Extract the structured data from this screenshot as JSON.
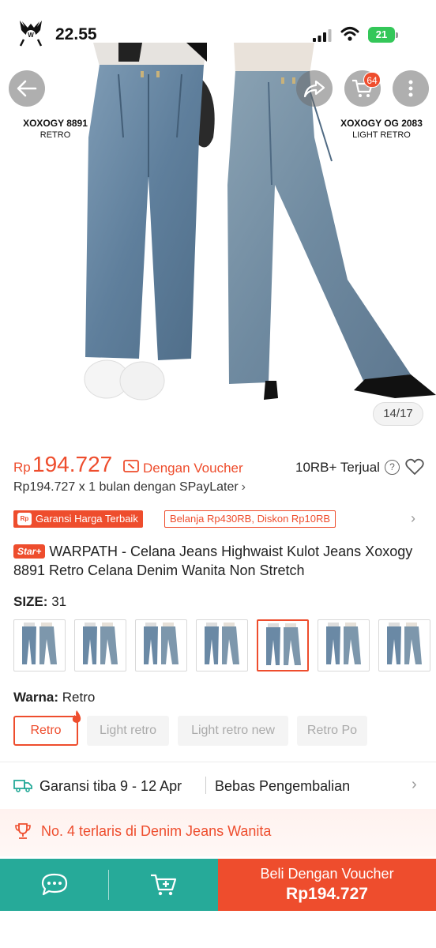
{
  "status_bar": {
    "time": "22.55",
    "battery": "21"
  },
  "hero": {
    "caption_left": {
      "name": "XOXOGY 8891",
      "sub": "RETRO"
    },
    "caption_right": {
      "name": "XOXOGY OG 2083",
      "sub": "LIGHT RETRO"
    },
    "image_counter": "14/17",
    "cart_count": "64"
  },
  "price": {
    "currency": "Rp",
    "amount": "194.727",
    "voucher_text": "Dengan Voucher",
    "sold": "10RB+ Terjual",
    "paylater": "Rp194.727 x 1 bulan dengan SPayLater"
  },
  "badges": {
    "guarantee": "Garansi Harga Terbaik",
    "guarantee_icon_text": "Rp",
    "discount": "Belanja Rp430RB, Diskon Rp10RB"
  },
  "product": {
    "star_badge": "Star+",
    "title": "WARPATH - Celana Jeans Highwaist Kulot Jeans Xoxogy 8891 Retro Celana Denim Wanita Non Stretch"
  },
  "size": {
    "label": "SIZE:",
    "value": "31",
    "selected_thumb": 5
  },
  "color": {
    "label": "Warna:",
    "value": "Retro",
    "options": [
      "Retro",
      "Light retro",
      "Light retro new",
      "Retro Po"
    ]
  },
  "shipping": {
    "eta": "Garansi tiba 9 - 12 Apr",
    "returns": "Bebas Pengembalian"
  },
  "bestseller": {
    "text": "No. 4 terlaris di Denim Jeans Wanita"
  },
  "bottom_bar": {
    "buy_label": "Beli Dengan Voucher",
    "buy_price": "Rp194.727"
  },
  "colors": {
    "accent": "#ee4d2d",
    "teal": "#26aa99",
    "battery": "#34c759"
  }
}
